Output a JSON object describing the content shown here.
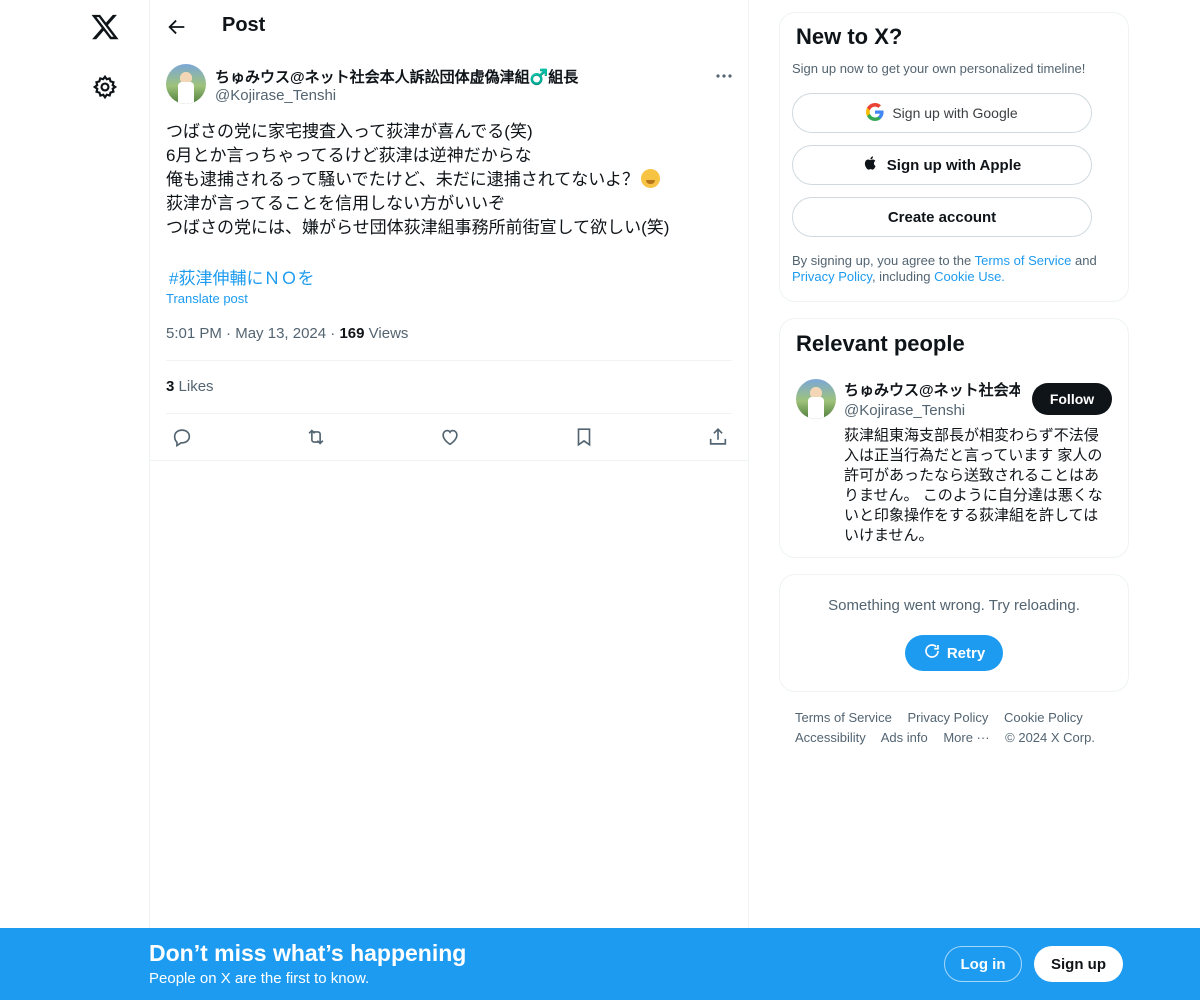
{
  "nav": {
    "logo_icon": "x-logo-icon",
    "settings_icon": "gear-icon"
  },
  "header": {
    "title": "Post"
  },
  "post": {
    "author_name": "ちゅみウス@ネット社会本人訴訟団体虚偽津組♂️組長",
    "author_handle": "@Kojirase_Tenshi",
    "lines": [
      "つばさの党に家宅捜査入って荻津が喜んでる(笑)",
      "6月とか言っちゃってるけど荻津は逆神だからな",
      "俺も逮捕されるって騒いでたけど、未だに逮捕されてないよ？",
      "荻津が言ってることを信用しない方がいいぞ",
      "つばさの党には、嫌がらせ団体荻津組事務所前街宣して欲しい(笑)"
    ],
    "hashtag": "#荻津伸輔にＮＯを",
    "translate_label": "Translate post",
    "time": "5:01 PM",
    "date": "May 13, 2024",
    "views_count": "169",
    "views_label": "Views",
    "likes_count": "3",
    "likes_label": "Likes"
  },
  "signup_card": {
    "title": "New to X?",
    "subtitle": "Sign up now to get your own personalized timeline!",
    "google_label": "Sign up with Google",
    "apple_label": "Sign up with Apple",
    "create_label": "Create account",
    "terms_prefix": "By signing up, you agree to the ",
    "terms_link": "Terms of Service",
    "terms_mid": " and ",
    "privacy_link": "Privacy Policy",
    "terms_mid2": ", including ",
    "cookie_link": "Cookie Use."
  },
  "relevant": {
    "title": "Relevant people",
    "name": "ちゅみウス@ネット社会本人訴訟団体虚偽津組♂️組長",
    "handle": "@Kojirase_Tenshi",
    "follow_label": "Follow",
    "bio": "荻津組東海支部長が相変わらず不法侵入は正当行為だと言っています 家人の許可があったなら送致されることはありません。 このように自分達は悪くないと印象操作をする荻津組を許してはいけません。"
  },
  "error_card": {
    "message": "Something went wrong. Try reloading.",
    "retry_label": "Retry"
  },
  "footer": {
    "links": [
      "Terms of Service",
      "Privacy Policy",
      "Cookie Policy",
      "Accessibility",
      "Ads info",
      "More ···",
      "© 2024 X Corp."
    ]
  },
  "bottom_bar": {
    "title": "Don’t miss what’s happening",
    "subtitle": "People on X are the first to know.",
    "login_label": "Log in",
    "signup_label": "Sign up"
  },
  "colors": {
    "accent": "#1d9bf0",
    "text": "#0f1419",
    "muted": "#536471",
    "border": "#eff3f4"
  }
}
